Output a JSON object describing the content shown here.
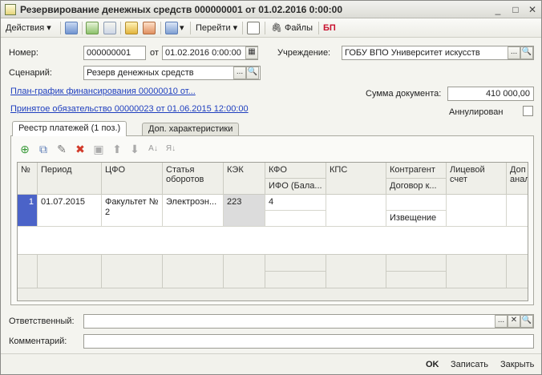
{
  "window": {
    "title": "Резервирование денежных средств 000000001 от 01.02.2016 0:00:00"
  },
  "toolbar": {
    "actions_label": "Действия",
    "goto_label": "Перейти",
    "files_label": "Файлы",
    "bp_label": "БП"
  },
  "form": {
    "number_label": "Номер:",
    "number_value": "000000001",
    "from_label": "от",
    "date_value": "01.02.2016  0:00:00",
    "institution_label": "Учреждение:",
    "institution_value": "ГОБУ ВПО Университет искусств",
    "scenario_label": "Сценарий:",
    "scenario_value": "Резерв денежных средств",
    "plan_link": "План-график финансирования 00000010 от...",
    "commitment_link": "Принятое обязательство 00000023 от 01.06.2015 12:00:00",
    "sum_label": "Сумма документа:",
    "sum_value": "410 000,00",
    "annulled_label": "Аннулирован",
    "responsible_label": "Ответственный:",
    "responsible_value": "",
    "comment_label": "Комментарий:",
    "comment_value": ""
  },
  "tabs": [
    {
      "label": "Реестр платежей (1 поз.)"
    },
    {
      "label": "Доп. характеристики"
    }
  ],
  "grid": {
    "headers": {
      "num": "№",
      "period": "Период",
      "cfo": "ЦФО",
      "article": "Статья оборотов",
      "kek": "КЭК",
      "kfo": "КФО",
      "ifo": "ИФО (Бала...",
      "kps": "КПС",
      "counterparty": "Контрагент",
      "contract": "Договор к...",
      "account": "Лицевой счет",
      "extra": "Доп анал"
    },
    "rows": [
      {
        "num": "1",
        "period": "01.07.2015",
        "cfo": "Факультет № 2",
        "article": "Электроэн...",
        "kek": "223",
        "kfo": "4",
        "ifo": "",
        "kps": "",
        "counterparty": "",
        "contract": "Извещение",
        "account": "",
        "extra": ""
      }
    ]
  },
  "bottom": {
    "ok_label": "OK",
    "save_label": "Записать",
    "close_label": "Закрыть"
  },
  "colors": {
    "link": "#1f3fbf",
    "row_marker": "#4b63c8",
    "kek_cell": "#dcdcdc"
  }
}
